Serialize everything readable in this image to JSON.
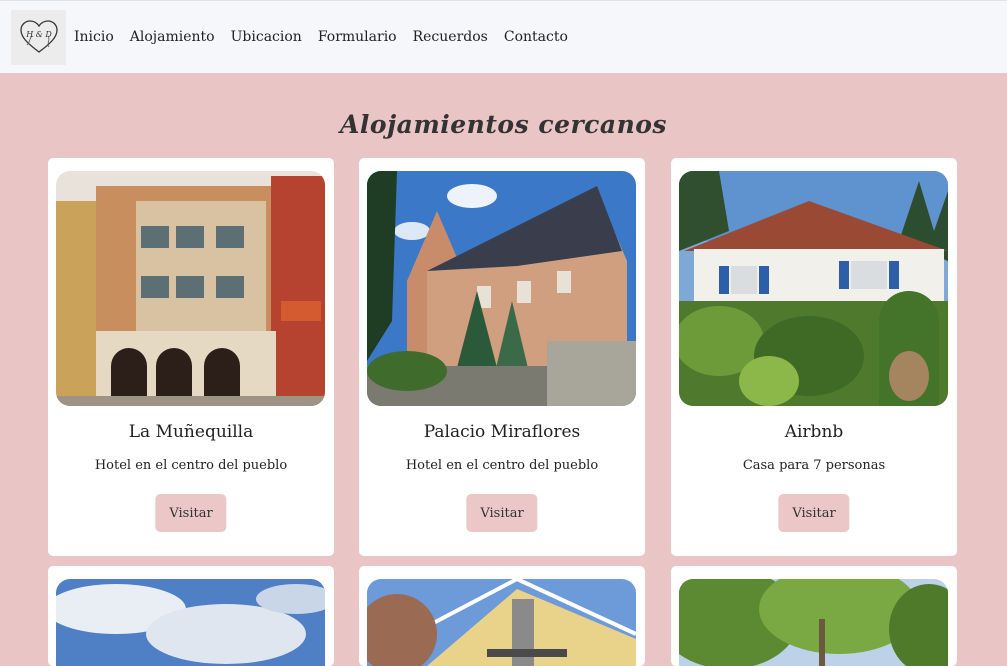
{
  "nav": {
    "logo_text": "H & D",
    "links": [
      "Inicio",
      "Alojamiento",
      "Ubicacion",
      "Formulario",
      "Recuerdos",
      "Contacto"
    ]
  },
  "section": {
    "title": "Alojamientos cercanos"
  },
  "cards": [
    {
      "title": "La Muñequilla",
      "text": "Hotel en el centro del pueblo",
      "button": "Visitar",
      "image": "hotel-building-photo"
    },
    {
      "title": "Palacio Miraflores",
      "text": "Hotel en el centro del pueblo",
      "button": "Visitar",
      "image": "palace-photo"
    },
    {
      "title": "Airbnb",
      "text": "Casa para 7 personas",
      "button": "Visitar",
      "image": "house-garden-photo"
    }
  ],
  "partial_cards": [
    {
      "image": "sky-clouds-photo"
    },
    {
      "image": "yellow-house-photo"
    },
    {
      "image": "trees-photo"
    }
  ],
  "colors": {
    "page_bg": "#e9c5c5",
    "navbar_bg": "#f5f7fa",
    "button_bg": "#ebc7c8",
    "card_bg": "#ffffff"
  }
}
